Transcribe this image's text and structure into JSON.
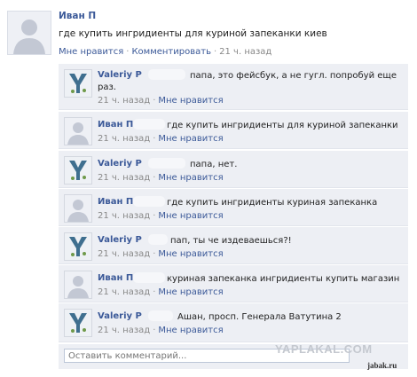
{
  "post": {
    "author": "Иван П",
    "text": "где купить ингридиенты для куриной запеканки киев",
    "like": "Мне нравится",
    "comment": "Комментировать",
    "sep": "·",
    "time": "21 ч. назад"
  },
  "comments": [
    {
      "author": "Valeriy P",
      "avatar": "y-logo-icon",
      "text_1": "папа, это фейсбук, а не гугл. попробуй еще",
      "text_2": "раз.",
      "time": "21 ч. назад",
      "like": "Мне нравится"
    },
    {
      "author": "Иван П",
      "avatar": "person-silhouette-icon",
      "text_1": "где купить ингридиенты для куриной запеканки",
      "time": "21 ч. назад",
      "like": "Мне нравится"
    },
    {
      "author": "Valeriy P",
      "avatar": "y-logo-icon",
      "text_1": "папа, нет.",
      "time": "21 ч. назад",
      "like": "Мне нравится"
    },
    {
      "author": "Иван П",
      "avatar": "person-silhouette-icon",
      "text_1": "где купить ингридиенты куриная запеканка",
      "time": "21 ч. назад",
      "like": "Мне нравится"
    },
    {
      "author": "Valeriy P",
      "avatar": "y-logo-icon",
      "text_1": "пап, ты че издеваешься?!",
      "time": "21 ч. назад",
      "like": "Мне нравится"
    },
    {
      "author": "Иван П",
      "avatar": "person-silhouette-icon",
      "text_1": "куриная запеканка ингридиенты купить магазин",
      "time": "21 ч. назад",
      "like": "Мне нравится"
    },
    {
      "author": "Valeriy P",
      "avatar": "y-logo-icon",
      "text_1": "Ашан, просп. Генерала Ватутина 2",
      "time": "21 ч. назад",
      "like": "Мне нравится"
    }
  ],
  "input": {
    "placeholder": "Оставить комментарий..."
  },
  "watermarks": {
    "main": "YAPLAKAL.COM",
    "small": "jabak.ru"
  },
  "colors": {
    "link": "#3b5998",
    "comment_bg": "#edeff4"
  }
}
